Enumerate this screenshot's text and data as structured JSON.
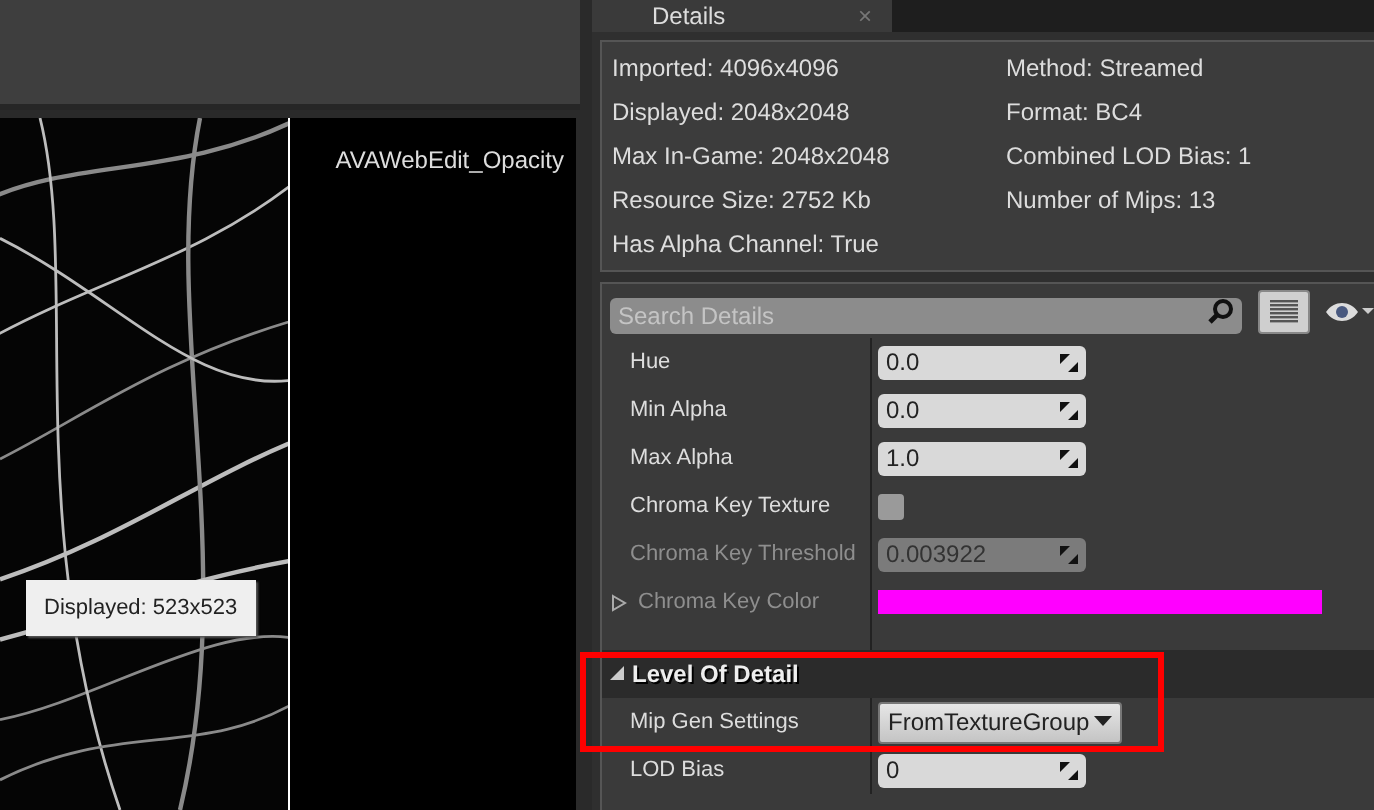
{
  "details_tab": {
    "title": "Details",
    "close": "×"
  },
  "viewport": {
    "texture_name": "AVAWebEdit_Opacity",
    "tooltip": "Displayed: 523x523"
  },
  "info": {
    "left": [
      "Imported: 4096x4096",
      "Displayed: 2048x2048",
      "Max In-Game: 2048x2048",
      "Resource Size: 2752 Kb",
      "Has Alpha Channel: True"
    ],
    "right": [
      "Method: Streamed",
      "Format: BC4",
      "Combined LOD Bias: 1",
      "Number of Mips: 13"
    ]
  },
  "search": {
    "placeholder": "Search Details"
  },
  "properties": [
    {
      "kind": "number",
      "label": "Hue",
      "value": "0.0",
      "disabled": false
    },
    {
      "kind": "number",
      "label": "Min Alpha",
      "value": "0.0",
      "disabled": false
    },
    {
      "kind": "number",
      "label": "Max Alpha",
      "value": "1.0",
      "disabled": false
    },
    {
      "kind": "checkbox",
      "label": "Chroma Key Texture",
      "checked": false,
      "disabled": false
    },
    {
      "kind": "number",
      "label": "Chroma Key Threshold",
      "value": "0.003922",
      "disabled": true
    },
    {
      "kind": "color",
      "label": "Chroma Key Color",
      "color": "#ff00ff",
      "expanded": false,
      "disabled": true
    }
  ],
  "section": {
    "title": "Level Of Detail",
    "expanded": true,
    "highlighted": true,
    "properties": [
      {
        "kind": "dropdown",
        "label": "Mip Gen Settings",
        "value": "FromTextureGroup",
        "disabled": false
      },
      {
        "kind": "number",
        "label": "LOD Bias",
        "value": "0",
        "disabled": false
      }
    ]
  }
}
